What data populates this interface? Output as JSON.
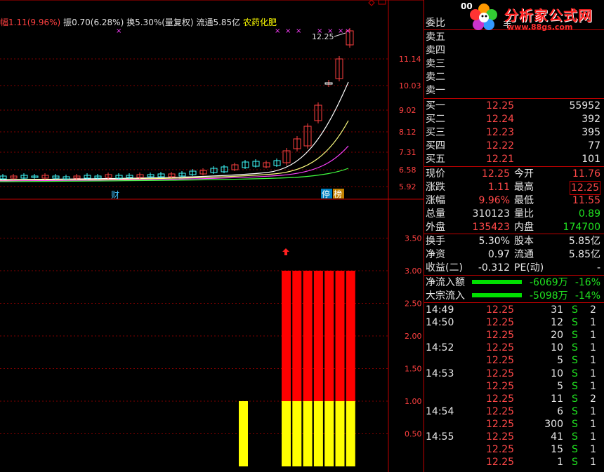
{
  "header": {
    "amplitude_label": "幅",
    "change": "1.11(9.96%)",
    "amp_label": "振",
    "amp": "0.70(6.28%)",
    "turnover_label": "换",
    "turnover": "5.30%",
    "adj": "(量复权)",
    "float_label": "流通",
    "float": "5.85亿",
    "sector": "农药化肥",
    "last_price_label": "12.25",
    "code_partial": "00",
    "name_partial": "丰"
  },
  "logo": {
    "title": "分析家公式网",
    "url": "www.88gs.com"
  },
  "price_axis": [
    "11.14",
    "10.03",
    "9.02",
    "8.12",
    "7.31",
    "6.58",
    "5.92"
  ],
  "indicator_axis": [
    "3.50",
    "3.00",
    "2.50",
    "2.00",
    "1.50",
    "1.00",
    "0.50"
  ],
  "chart_markers": {
    "cai": "财",
    "ting": "停",
    "bang": "榜"
  },
  "chart_data": {
    "type": "bar",
    "title": "",
    "ylim": [
      0,
      3.7
    ],
    "series": [
      {
        "color": "#ffff00",
        "values": [
          1,
          0,
          0,
          0,
          1,
          1,
          1,
          1,
          1,
          1
        ]
      },
      {
        "color": "#ff0000",
        "values": [
          0,
          0,
          0,
          0,
          2,
          2,
          2,
          2,
          2,
          2
        ]
      }
    ],
    "grid": true
  },
  "order_book": {
    "ratio_label": "委比",
    "asks": [
      {
        "label": "卖五"
      },
      {
        "label": "卖四"
      },
      {
        "label": "卖三"
      },
      {
        "label": "卖二"
      },
      {
        "label": "卖一"
      }
    ],
    "bids": [
      {
        "label": "买一",
        "price": "12.25",
        "vol": "55952"
      },
      {
        "label": "买二",
        "price": "12.24",
        "vol": "392"
      },
      {
        "label": "买三",
        "price": "12.23",
        "vol": "395"
      },
      {
        "label": "买四",
        "price": "12.22",
        "vol": "77"
      },
      {
        "label": "买五",
        "price": "12.21",
        "vol": "101"
      }
    ]
  },
  "quote": [
    {
      "l1": "现价",
      "v1": "12.25",
      "c1": "red",
      "l2": "今开",
      "v2": "11.76",
      "c2": "red"
    },
    {
      "l1": "涨跌",
      "v1": "1.11",
      "c1": "red",
      "l2": "最高",
      "v2": "12.25",
      "c2": "red"
    },
    {
      "l1": "涨幅",
      "v1": "9.96%",
      "c1": "red",
      "l2": "最低",
      "v2": "11.55",
      "c2": "red"
    },
    {
      "l1": "总量",
      "v1": "310123",
      "c1": "wt",
      "l2": "量比",
      "v2": "0.89",
      "c2": "grn"
    },
    {
      "l1": "外盘",
      "v1": "135423",
      "c1": "red",
      "l2": "内盘",
      "v2": "174700",
      "c2": "grn"
    }
  ],
  "fundamentals": [
    {
      "l1": "换手",
      "v1": "5.30%",
      "l2": "股本",
      "v2": "5.85亿"
    },
    {
      "l1": "净资",
      "v1": "0.97",
      "l2": "流通",
      "v2": "5.85亿"
    },
    {
      "l1": "收益(二)",
      "v1": "-0.312",
      "l2": "PE(动)",
      "v2": "-"
    }
  ],
  "flows": [
    {
      "label": "净流入额",
      "value": "-6069万",
      "pct": "-16%",
      "level": 0.98
    },
    {
      "label": "大宗流入",
      "value": "-5098万",
      "pct": "-14%",
      "level": 0.98
    }
  ],
  "ticks": [
    {
      "time": "14:49",
      "price": "12.25",
      "vol": "31",
      "side": "S",
      "n": "2"
    },
    {
      "time": "14:50",
      "price": "12.25",
      "vol": "12",
      "side": "S",
      "n": "1"
    },
    {
      "time": "",
      "price": "12.25",
      "vol": "20",
      "side": "S",
      "n": "1"
    },
    {
      "time": "14:52",
      "price": "12.25",
      "vol": "10",
      "side": "S",
      "n": "1"
    },
    {
      "time": "",
      "price": "12.25",
      "vol": "5",
      "side": "S",
      "n": "1"
    },
    {
      "time": "14:53",
      "price": "12.25",
      "vol": "10",
      "side": "S",
      "n": "1"
    },
    {
      "time": "",
      "price": "12.25",
      "vol": "5",
      "side": "S",
      "n": "1"
    },
    {
      "time": "",
      "price": "12.25",
      "vol": "11",
      "side": "S",
      "n": "2"
    },
    {
      "time": "14:54",
      "price": "12.25",
      "vol": "6",
      "side": "S",
      "n": "1"
    },
    {
      "time": "",
      "price": "12.25",
      "vol": "300",
      "side": "S",
      "n": "1"
    },
    {
      "time": "14:55",
      "price": "12.25",
      "vol": "41",
      "side": "S",
      "n": "1"
    },
    {
      "time": "",
      "price": "12.25",
      "vol": "15",
      "side": "S",
      "n": "1"
    },
    {
      "time": "",
      "price": "12.25",
      "vol": "1",
      "side": "S",
      "n": "1"
    }
  ]
}
